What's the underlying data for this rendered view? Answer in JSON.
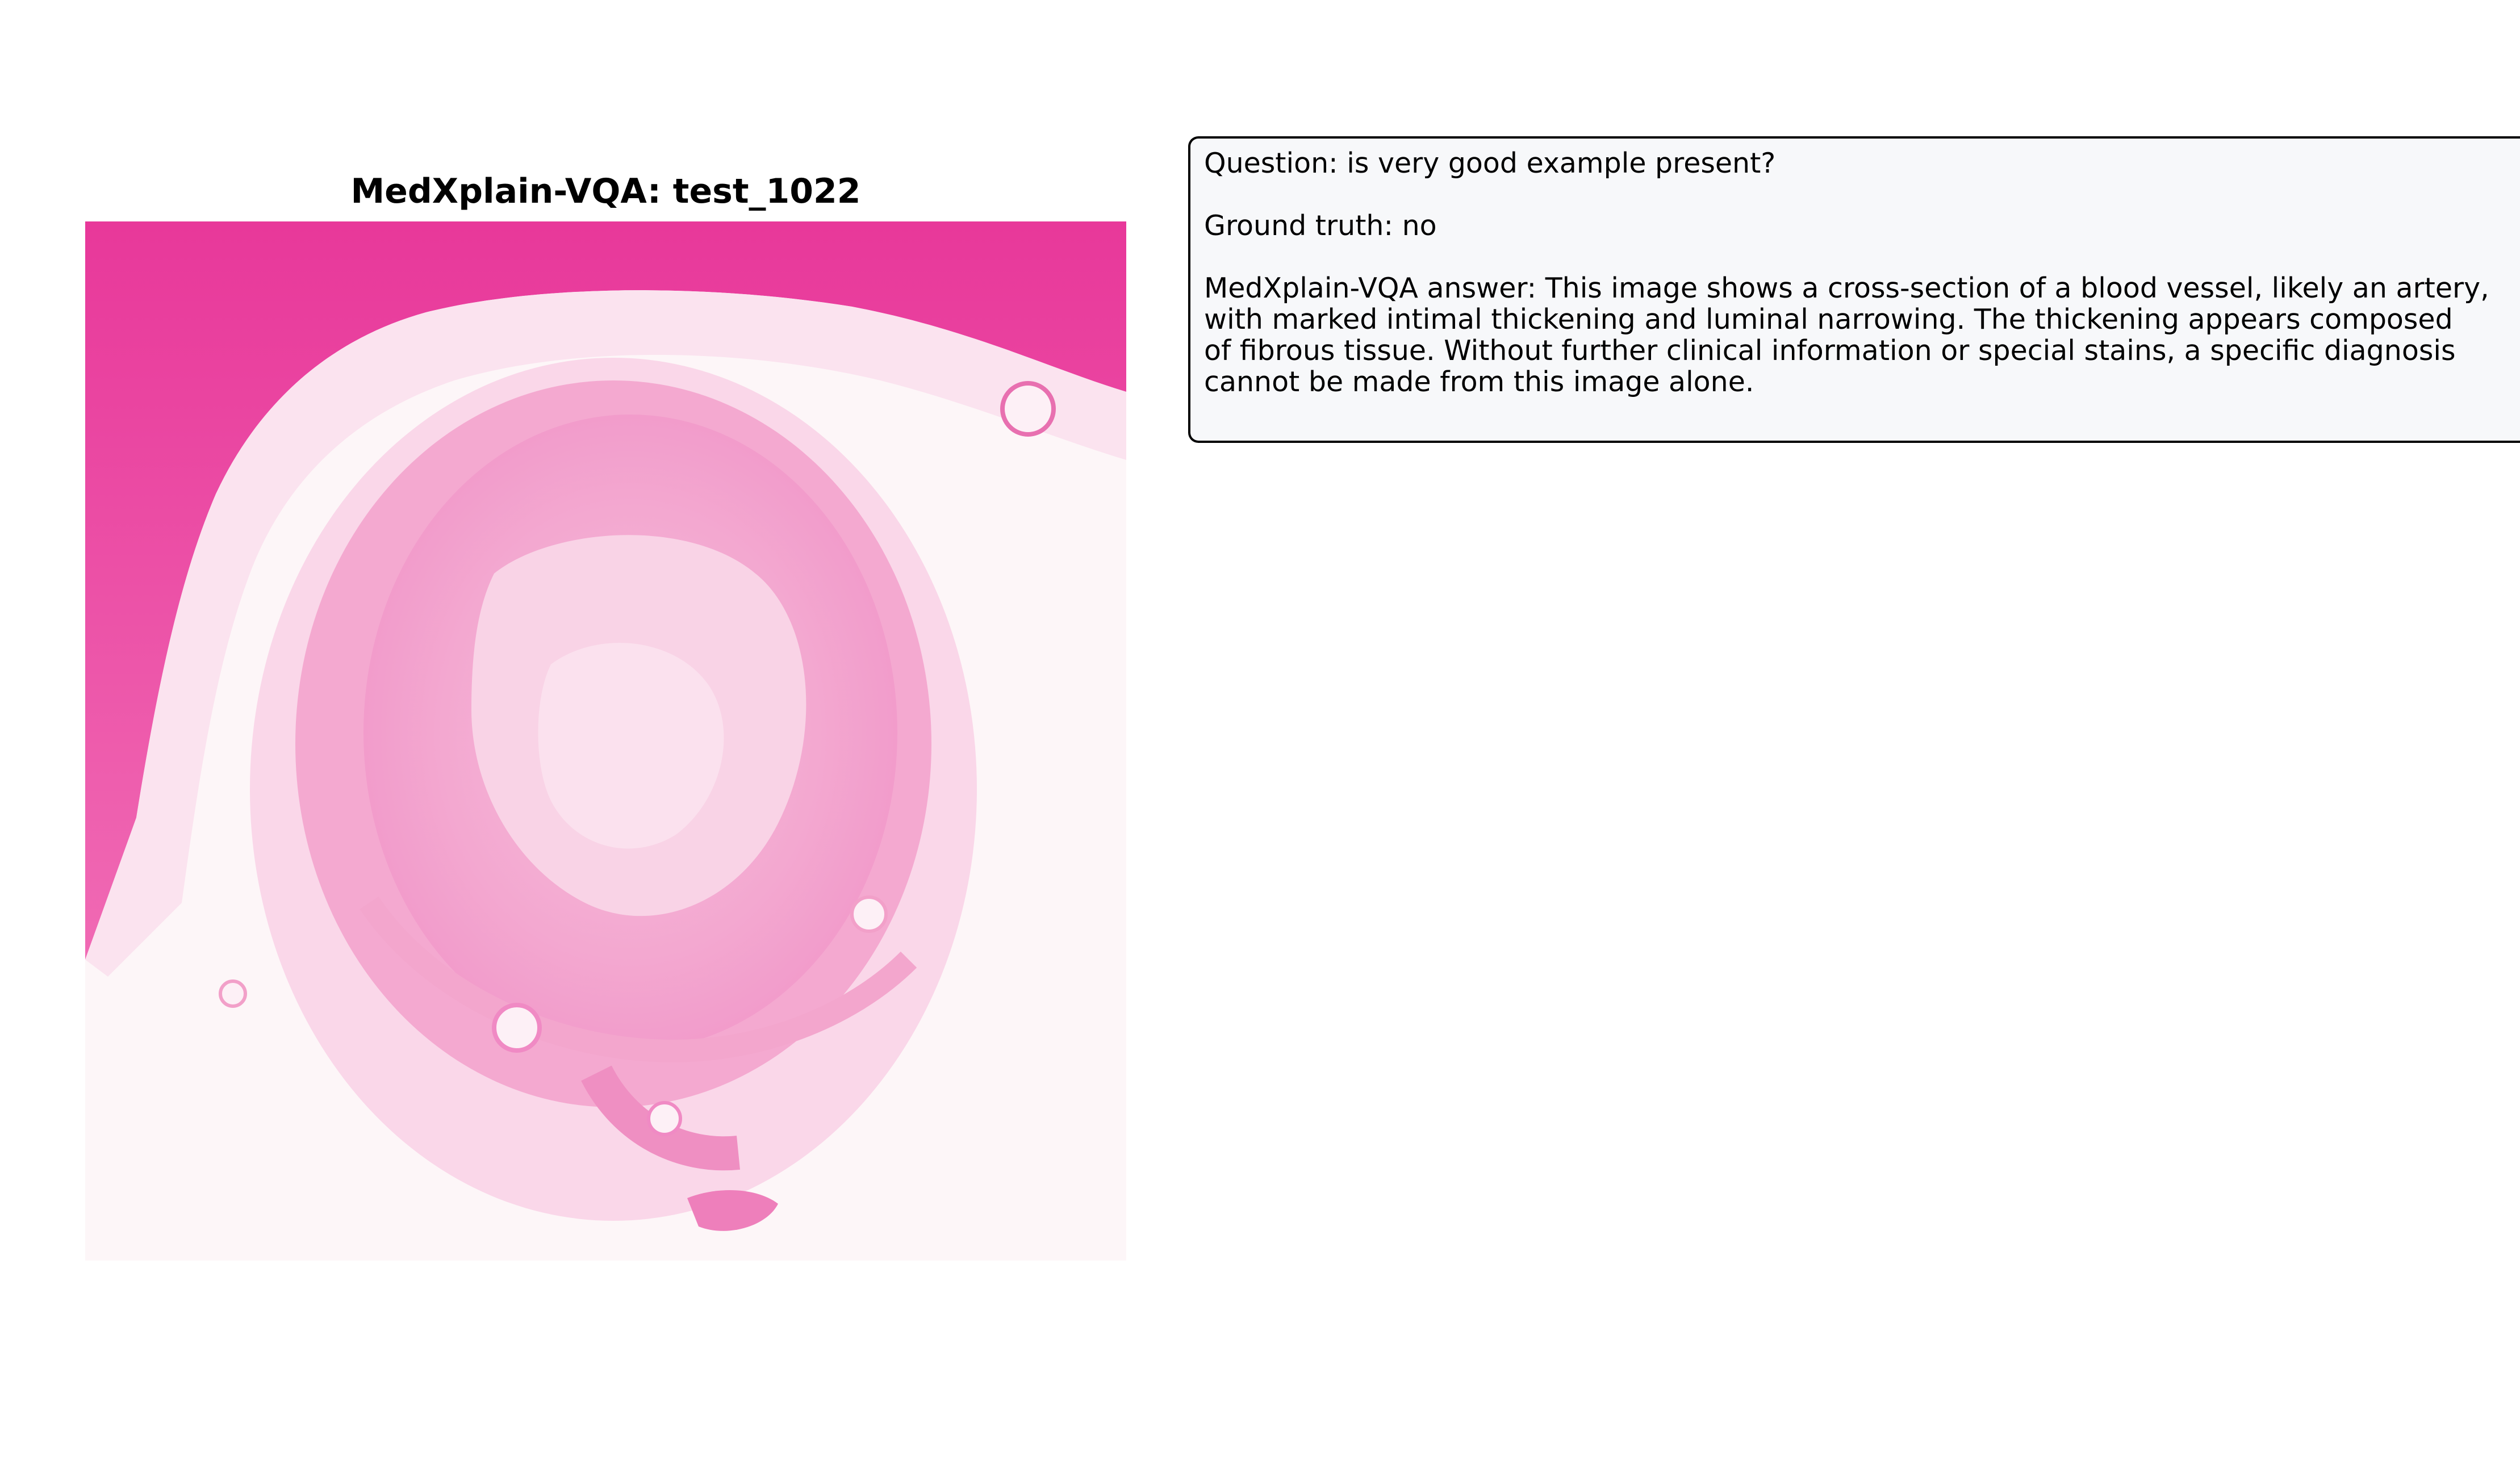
{
  "figure": {
    "title": "MedXplain-VQA: test_1022"
  },
  "panel": {
    "question": "Question: is very good example present?",
    "ground_truth": "Ground truth: no",
    "answer_lines": [
      "MedXplain-VQA answer: This image shows a cross-section of a blood vessel, likely an artery,",
      "with marked intimal thickening and luminal narrowing.  The thickening appears composed",
      "of fibrous tissue.  Without further clinical information or special stains, a specific diagnosis",
      "cannot be made from this image alone."
    ]
  },
  "colors": {
    "background": "#ffffff",
    "panel_background": "#f7f8fa",
    "panel_border": "#000000",
    "stain_dark": "#e8389a",
    "stain_mid": "#f08ac4",
    "stain_light": "#f9c9e1"
  }
}
